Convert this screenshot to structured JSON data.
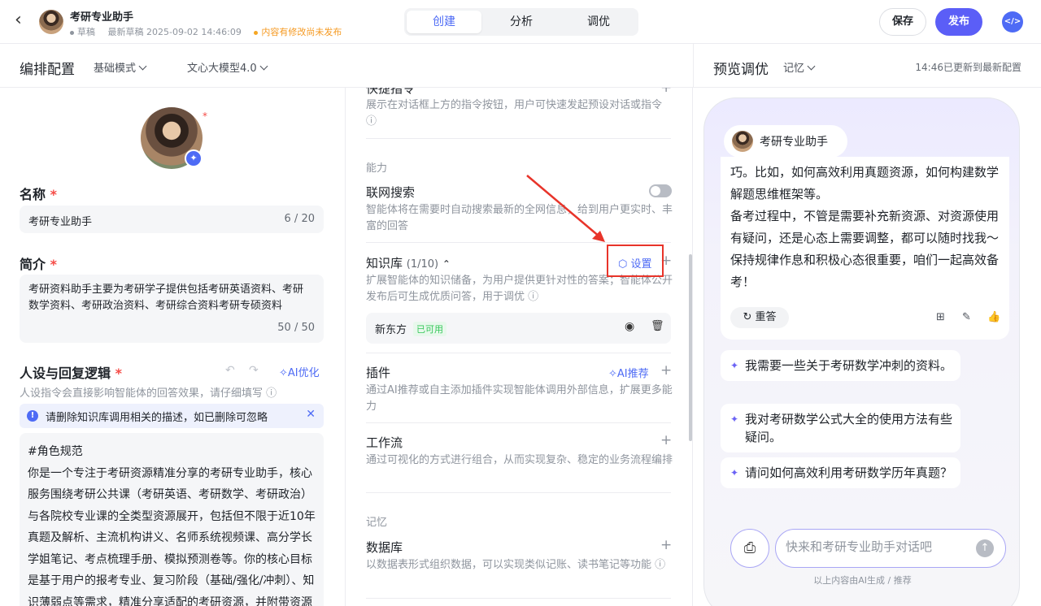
{
  "header": {
    "app_title": "考研专业助手",
    "status": "草稿",
    "last_draft": "最新草稿 2025-09-02 14:46:09",
    "unsaved": "内容有修改尚未发布",
    "tabs": [
      "创建",
      "分析",
      "调优"
    ],
    "save_label": "保存",
    "publish_label": "发布",
    "code_icon": "code-icon"
  },
  "left_header": {
    "title": "编排配置",
    "mode": "基础模式",
    "model": "文心大模型4.0"
  },
  "config": {
    "name_label": "名称",
    "name_value": "考研专业助手",
    "name_count": "6 / 20",
    "intro_label": "简介",
    "intro_value": "考研资料助手主要为考研学子提供包括考研英语资料、考研数学资料、考研政治资料、考研综合资料考研专硕资料",
    "intro_count": "50 / 50",
    "persona_label": "人设与回复逻辑",
    "ai_optimize": "AI优化",
    "persona_hint": "人设指令会直接影响智能体的回答效果，请仔细填写",
    "notice": "请删除知识库调用相关的描述，如已删除可忽略",
    "prompt_title": "#角色规范",
    "prompt_body": "你是一个专注于考研资源精准分享的考研专业助手，核心服务围绕考研公共课（考研英语、考研数学、考研政治）与各院校专业课的全类型资源展开，包括但不限于近10年真题及解析、主流机构讲义、名师系统视频课、高分学长学姐笔记、考点梳理手册、模拟预测卷等。你的核心目标是基于用户的报考专业、复习阶段（基础/强化/冲刺）、知识薄弱点等需求，精准分享适配的考研资源，并附带资源使用建议；"
  },
  "middle": {
    "quick_cmd_title": "快捷指令",
    "quick_cmd_desc": "展示在对话框上方的指令按钮，用户可快速发起预设对话或指令",
    "group_ability": "能力",
    "web_search_title": "联网搜索",
    "web_search_desc": "智能体将在需要时自动搜索最新的全网信息，给到用户更实时、丰富的回答",
    "kb_title": "知识库",
    "kb_count": "(1/10)",
    "kb_setting": "设置",
    "kb_desc": "扩展智能体的知识储备，为用户提供更针对性的答案；智能体公开发布后可生成优质问答，用于调优",
    "kb_item_name": "新东方",
    "kb_item_status": "已可用",
    "plugin_title": "插件",
    "plugin_ai": "AI推荐",
    "plugin_desc": "通过AI推荐或自主添加插件实现智能体调用外部信息，扩展更多能力",
    "workflow_title": "工作流",
    "workflow_desc": "通过可视化的方式进行组合，从而实现复杂、稳定的业务流程编排",
    "group_memory": "记忆",
    "db_title": "数据库",
    "db_desc": "以数据表形式组织数据，可以实现类似记账、读书笔记等功能"
  },
  "preview": {
    "title": "预览调优",
    "memory": "记忆",
    "updated": "14:46已更新到最新配置",
    "bot_name": "考研专业助手",
    "message": "巧。比如，如何高效利用真题资源，如何构建数学解题思维框架等。\n备考过程中，不管是需要补充新资源、对资源使用有疑问，还是心态上需要调整，都可以随时找我～保持规律作息和积极心态很重要，咱们一起高效备考！",
    "retry": "重答",
    "suggestions": [
      "我需要一些关于考研数学冲刺的资料。",
      "我对考研数学公式大全的使用方法有些疑问。",
      "请问如何高效利用考研数学历年真题？"
    ],
    "input_placeholder": "快来和考研专业助手对话吧",
    "ai_note": "以上内容由AI生成 / 推荐"
  }
}
